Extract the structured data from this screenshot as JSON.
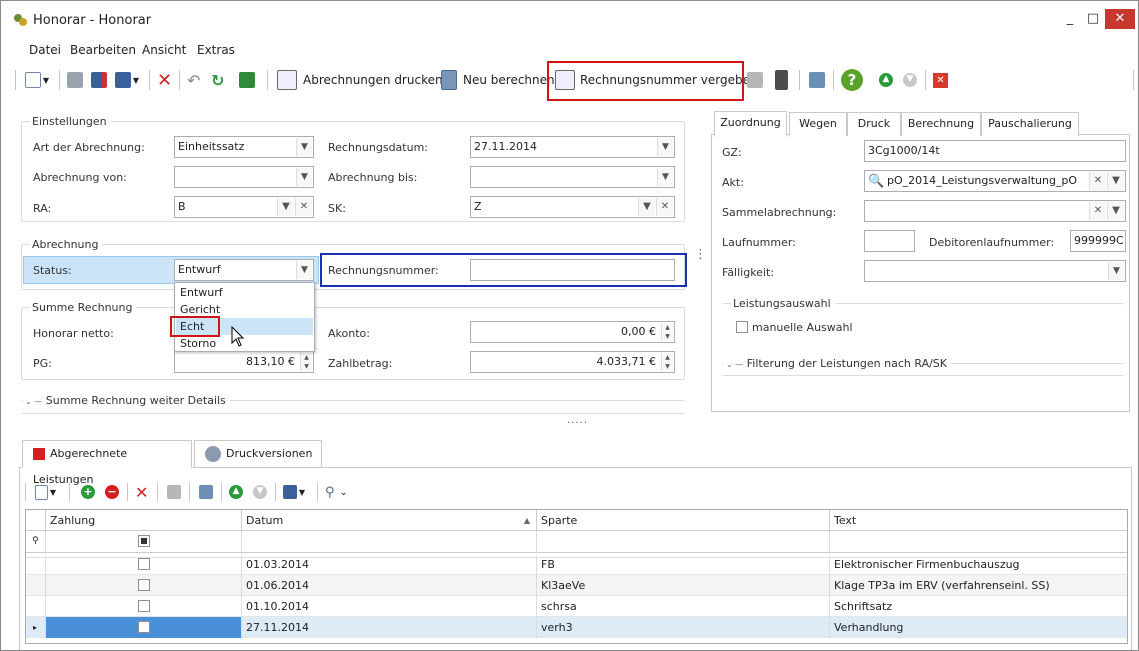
{
  "window": {
    "title": "Honorar - Honorar",
    "minimize": "_",
    "maximize": "□",
    "close": "✕"
  },
  "menu": [
    "Datei",
    "Bearbeiten",
    "Ansicht",
    "Extras"
  ],
  "toolbar": {
    "print_label": "Abrechnungen drucken",
    "recalc_label": "Neu berechnen",
    "assign_label": "Rechnungsnummer vergeben"
  },
  "einstellungen": {
    "title": "Einstellungen",
    "art_label": "Art der Abrechnung:",
    "art_value": "Einheitssatz",
    "datum_label": "Rechnungsdatum:",
    "datum_value": "27.11.2014",
    "von_label": "Abrechnung von:",
    "von_value": "",
    "bis_label": "Abrechnung bis:",
    "bis_value": "",
    "ra_label": "RA:",
    "ra_value": "B",
    "sk_label": "SK:",
    "sk_value": "Z"
  },
  "abrechnung": {
    "title": "Abrechnung",
    "status_label": "Status:",
    "status_value": "Entwurf",
    "rn_label": "Rechnungsnummer:",
    "rn_value": "",
    "options": [
      "Entwurf",
      "Gericht",
      "Echt",
      "Storno"
    ]
  },
  "summe": {
    "title": "Summe Rechnung",
    "netto_label": "Honorar netto:",
    "akonto_label": "Akonto:",
    "akonto_value": "0,00 €",
    "pg_label": "PG:",
    "pg_value": "813,10 €",
    "zahl_label": "Zahlbetrag:",
    "zahl_value": "4.033,71 €",
    "details_label": "Summe Rechnung weiter Details"
  },
  "right_tabs": [
    "Zuordnung",
    "Wegen",
    "Druck",
    "Berechnung",
    "Pauschalierung"
  ],
  "zuordnung": {
    "gz_label": "GZ:",
    "gz_value": "3Cg1000/14t",
    "akt_label": "Akt:",
    "akt_value": "pO_2014_Leistungsverwaltung_pO",
    "sammel_label": "Sammelabrechnung:",
    "sammel_value": "",
    "lauf_label": "Laufnummer:",
    "lauf_value": "",
    "debitor_label": "Debitorenlaufnummer:",
    "debitor_value": "999999C",
    "faellig_label": "Fälligkeit:",
    "faellig_value": "",
    "leistung_title": "Leistungsauswahl",
    "manuell_label": "manuelle Auswahl",
    "filter_label": "Filterung der Leistungen nach RA/SK"
  },
  "bottom_tabs": [
    "Abgerechnete Leistungen",
    "Druckversionen"
  ],
  "grid": {
    "columns": [
      "Zahlung",
      "Datum",
      "Sparte",
      "Text"
    ],
    "rows": [
      {
        "datum": "01.03.2014",
        "sparte": "FB",
        "text": "Elektronischer Firmenbuchauszug"
      },
      {
        "datum": "01.06.2014",
        "sparte": "Kl3aeVe",
        "text": "Klage TP3a im ERV (verfahrenseinl. SS)"
      },
      {
        "datum": "01.10.2014",
        "sparte": "schrsa",
        "text": "Schriftsatz"
      },
      {
        "datum": "27.11.2014",
        "sparte": "verh3",
        "text": "Verhandlung"
      }
    ]
  },
  "colors": {
    "highlight_red": "#d41414",
    "highlight_blue": "#1b2fb2",
    "selection": "#cce4f7",
    "selected_row": "#4a90d9"
  }
}
